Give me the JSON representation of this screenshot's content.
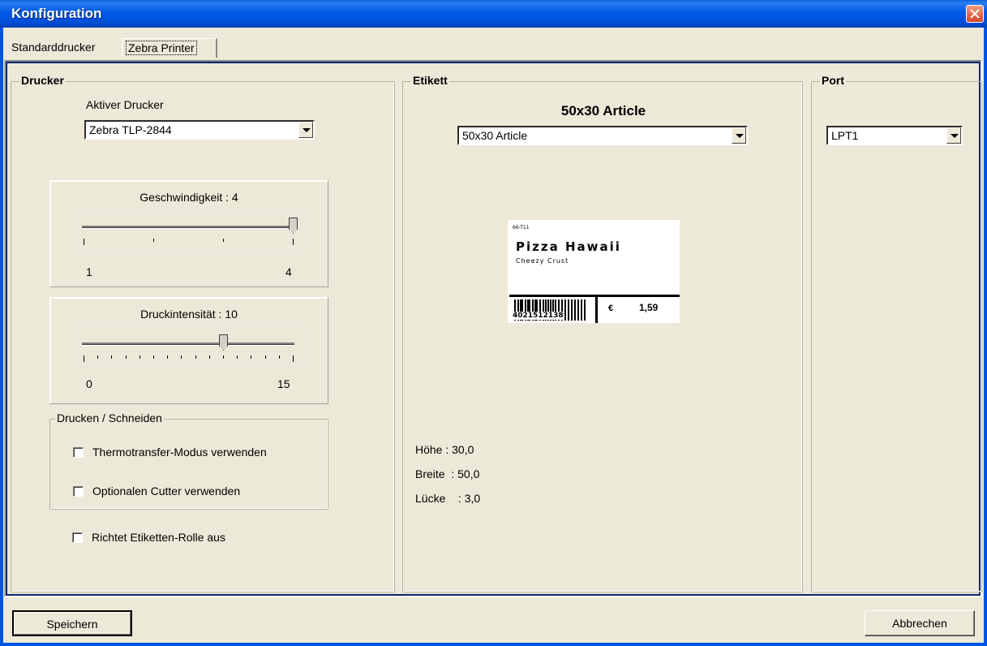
{
  "window": {
    "title": "Konfiguration"
  },
  "tabs": [
    {
      "label": "Standarddrucker"
    },
    {
      "label": "Zebra Printer"
    }
  ],
  "drucker": {
    "legend": "Drucker",
    "active_printer_label": "Aktiver Drucker",
    "active_printer_value": "Zebra TLP-2844",
    "speed": {
      "label": "Geschwindigkeit : 4",
      "min": "1",
      "max": "4",
      "value": 4,
      "range": [
        1,
        4
      ]
    },
    "intensity": {
      "label": "Druckintensität : 10",
      "min": "0",
      "max": "15",
      "value": 10,
      "range": [
        0,
        15
      ]
    },
    "print_cut": {
      "legend": "Drucken / Schneiden",
      "thermo_label": "Thermotransfer-Modus verwenden",
      "thermo_checked": false,
      "cutter_label": "Optionalen Cutter verwenden",
      "cutter_checked": false
    },
    "align_roll_label": "Richtet Etiketten-Rolle aus",
    "align_roll_checked": false
  },
  "etikett": {
    "legend": "Etikett",
    "heading": "50x30 Article",
    "select_value": "50x30 Article",
    "preview": {
      "code": "66-T11",
      "title": "Pizza Hawaii",
      "subtitle": "Cheezy Crust",
      "barcode_number": "4021512138",
      "currency": "€",
      "price": "1,59"
    },
    "hoehe": "Höhe : 30,0",
    "breite": "Breite  : 50,0",
    "luecke": "Lücke    : 3,0"
  },
  "port": {
    "legend": "Port",
    "value": "LPT1"
  },
  "buttons": {
    "save": "Speichern",
    "cancel": "Abbrechen"
  }
}
